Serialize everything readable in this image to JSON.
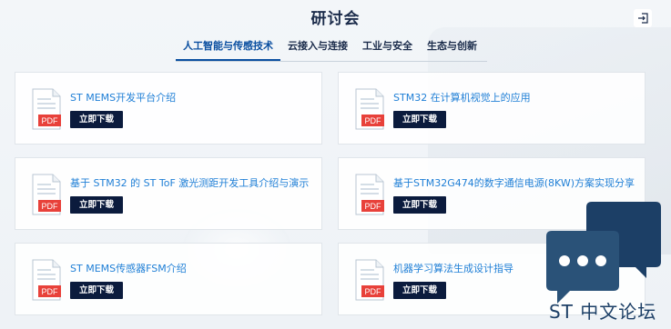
{
  "page": {
    "title": "研讨会"
  },
  "tabs": [
    {
      "label": "人工智能与传感技术",
      "active": true
    },
    {
      "label": "云接入与连接",
      "active": false
    },
    {
      "label": "工业与安全",
      "active": false
    },
    {
      "label": "生态与创新",
      "active": false
    }
  ],
  "cards": [
    {
      "title": "ST MEMS开发平台介绍",
      "download": "立即下载",
      "file_badge": "PDF"
    },
    {
      "title": "STM32 在计算机视觉上的应用",
      "download": "立即下载",
      "file_badge": "PDF"
    },
    {
      "title": "基于 STM32 的 ST ToF 激光测距开发工具介绍与演示",
      "download": "立即下载",
      "file_badge": "PDF"
    },
    {
      "title": "基于STM32G474的数字通信电源(8KW)方案实现分享",
      "download": "立即下载",
      "file_badge": "PDF"
    },
    {
      "title": "ST MEMS传感器FSM介绍",
      "download": "立即下载",
      "file_badge": "PDF"
    },
    {
      "title": "机器学习算法生成设计指导",
      "download": "立即下载",
      "file_badge": "PDF"
    }
  ],
  "forum": {
    "label": "ST 中文论坛",
    "icon": "chat-bubbles-icon"
  },
  "colors": {
    "accent": "#0a4fa0",
    "button": "#0b1b3d",
    "link": "#1f7fd6",
    "pdf_red": "#e8413a"
  }
}
